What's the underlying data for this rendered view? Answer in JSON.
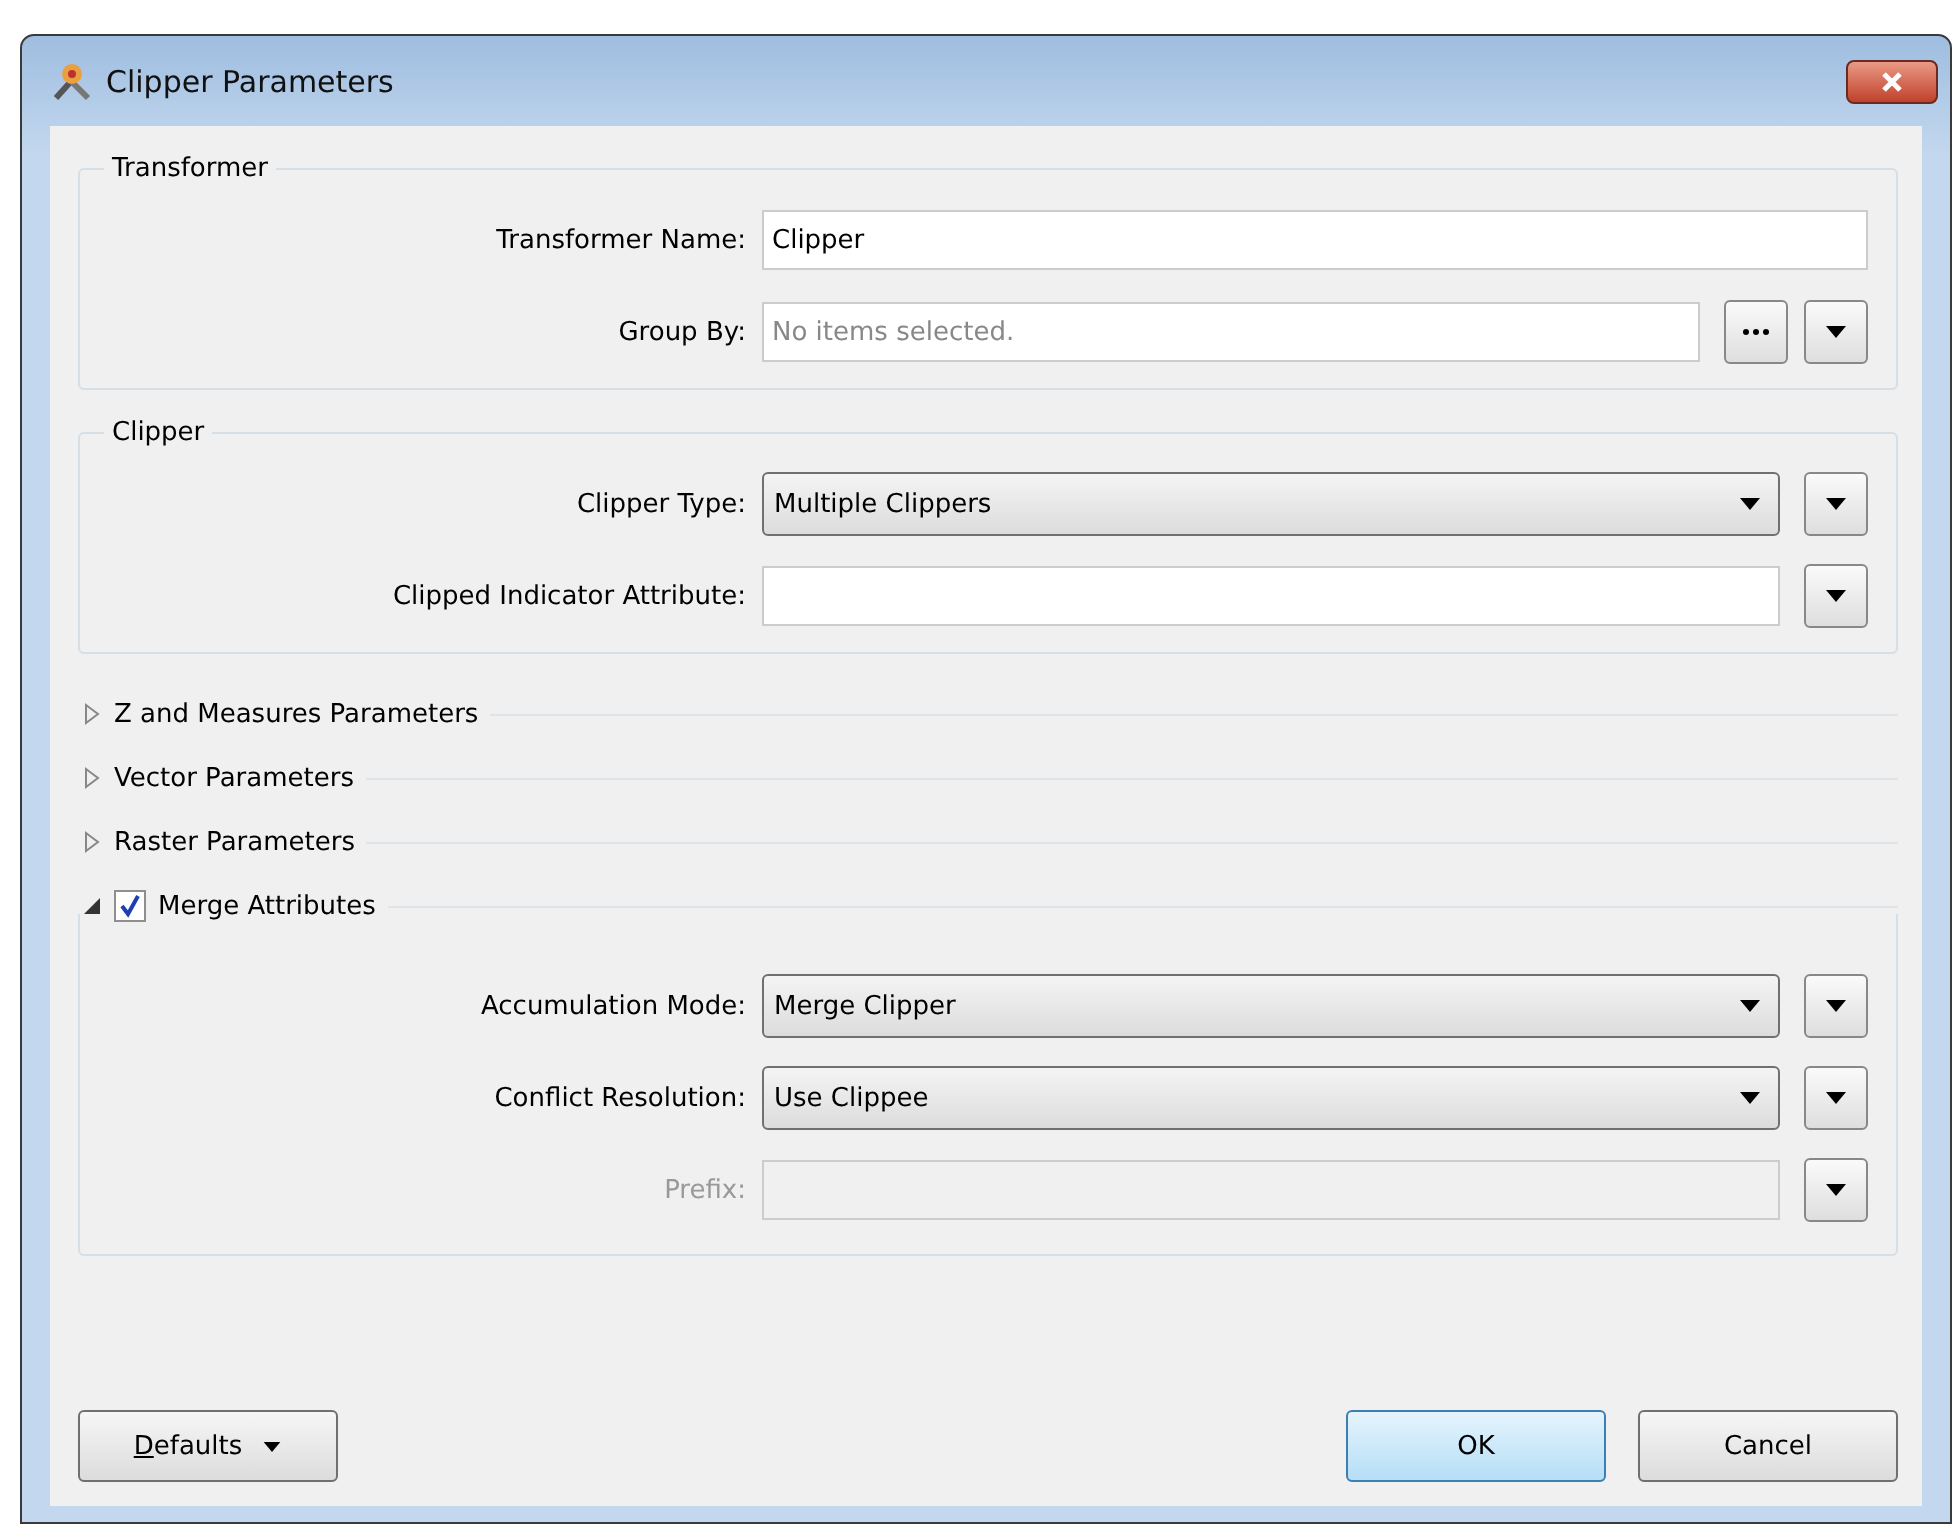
{
  "window": {
    "title": "Clipper Parameters"
  },
  "sections": [
    {
      "kind": "group",
      "title": "Transformer",
      "rows": [
        {
          "label": "Transformer Name:",
          "kind": "text",
          "value": "Clipper",
          "disabled": false
        },
        {
          "label": "Group By:",
          "kind": "text",
          "placeholder": "No items selected.",
          "disabled": false,
          "buttons": [
            {
              "kind": "browse"
            },
            {
              "kind": "menu"
            }
          ]
        }
      ]
    },
    {
      "kind": "group",
      "title": "Clipper",
      "rows": [
        {
          "label": "Clipper Type:",
          "kind": "combo",
          "value": "Multiple Clippers",
          "disabled": false,
          "buttons": [
            {
              "kind": "menu"
            }
          ]
        },
        {
          "label": "Clipped Indicator Attribute:",
          "kind": "text",
          "value": "",
          "disabled": false,
          "buttons": [
            {
              "kind": "menu"
            }
          ]
        }
      ]
    },
    {
      "kind": "collapsible",
      "title": "Z and Measures Parameters",
      "expanded": false
    },
    {
      "kind": "collapsible",
      "title": "Vector Parameters",
      "expanded": false
    },
    {
      "kind": "collapsible",
      "title": "Raster Parameters",
      "expanded": false
    },
    {
      "kind": "collapsible",
      "title": "Merge Attributes",
      "expanded": true,
      "checked": true,
      "rows": [
        {
          "label": "Accumulation Mode:",
          "kind": "combo",
          "value": "Merge Clipper",
          "disabled": false,
          "buttons": [
            {
              "kind": "menu"
            }
          ]
        },
        {
          "label": "Conflict Resolution:",
          "kind": "combo",
          "value": "Use Clippee",
          "disabled": false,
          "buttons": [
            {
              "kind": "menu"
            }
          ]
        },
        {
          "label": "Prefix:",
          "kind": "text",
          "value": "",
          "disabled": true,
          "buttons": [
            {
              "kind": "menu"
            }
          ]
        }
      ]
    }
  ],
  "footer": {
    "defaults": "Defaults",
    "ok": "OK",
    "cancel": "Cancel"
  }
}
